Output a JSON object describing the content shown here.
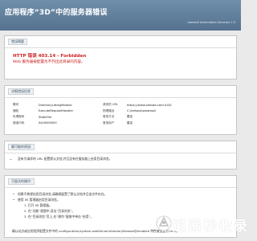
{
  "header": {
    "title": "应用程序“3D”中的服务器错误",
    "version": "Internet Information Services 7.5"
  },
  "error_summary": {
    "tag": "错误摘要",
    "title": "HTTP 错误 403.14 - Forbidden",
    "description": "Web 服务器被配置为不列出此目录的内容。"
  },
  "details": {
    "tag": "详细错误信息",
    "rows": [
      {
        "k1": "模块",
        "v1": "DirectoryListingModule",
        "k2": "请求的 URL",
        "v2": "https://www.xleoad.com:443/"
      },
      {
        "k1": "通知",
        "v1": "ExecuteRequestHandler",
        "k2": "物理路径",
        "v2": "C:\\inetpub\\wwwroot"
      },
      {
        "k1": "处理程序",
        "v1": "StaticFile",
        "k2": "登录方法",
        "v2": "匿名"
      },
      {
        "k1": "错误代码",
        "v1": "0x00000000",
        "k2": "登录用户",
        "v2": "匿名"
      }
    ]
  },
  "causes": {
    "tag": "最可能的原因:",
    "items": [
      "没有为请求的 URL 配置默认文档,并且没有在服务器上启用目录浏览。"
    ]
  },
  "solutions": {
    "tag": "可尝试的操作:",
    "lines": [
      "如果不希望启用目录浏览,请确保配置了默认文档并且该文件存在。",
      "使用 IIS 管理器启用目录浏览。",
      "1. 打开 IIS 管理器。",
      "2. 在“功能”视图中,双击“目录浏览”。",
      "3. 在“目录浏览”页上,在“操作”窗格中单击“启用”。",
      "确认站点或应用程序配置文件中的 configuration/system.webServer/directoryBrowse@enabled 特性被设置为 true。"
    ]
  },
  "watermark": "逍遥秒收录",
  "colors": {
    "header": "#5f7f9c",
    "error_red": "#cc2222",
    "background": "#eaeaea"
  }
}
